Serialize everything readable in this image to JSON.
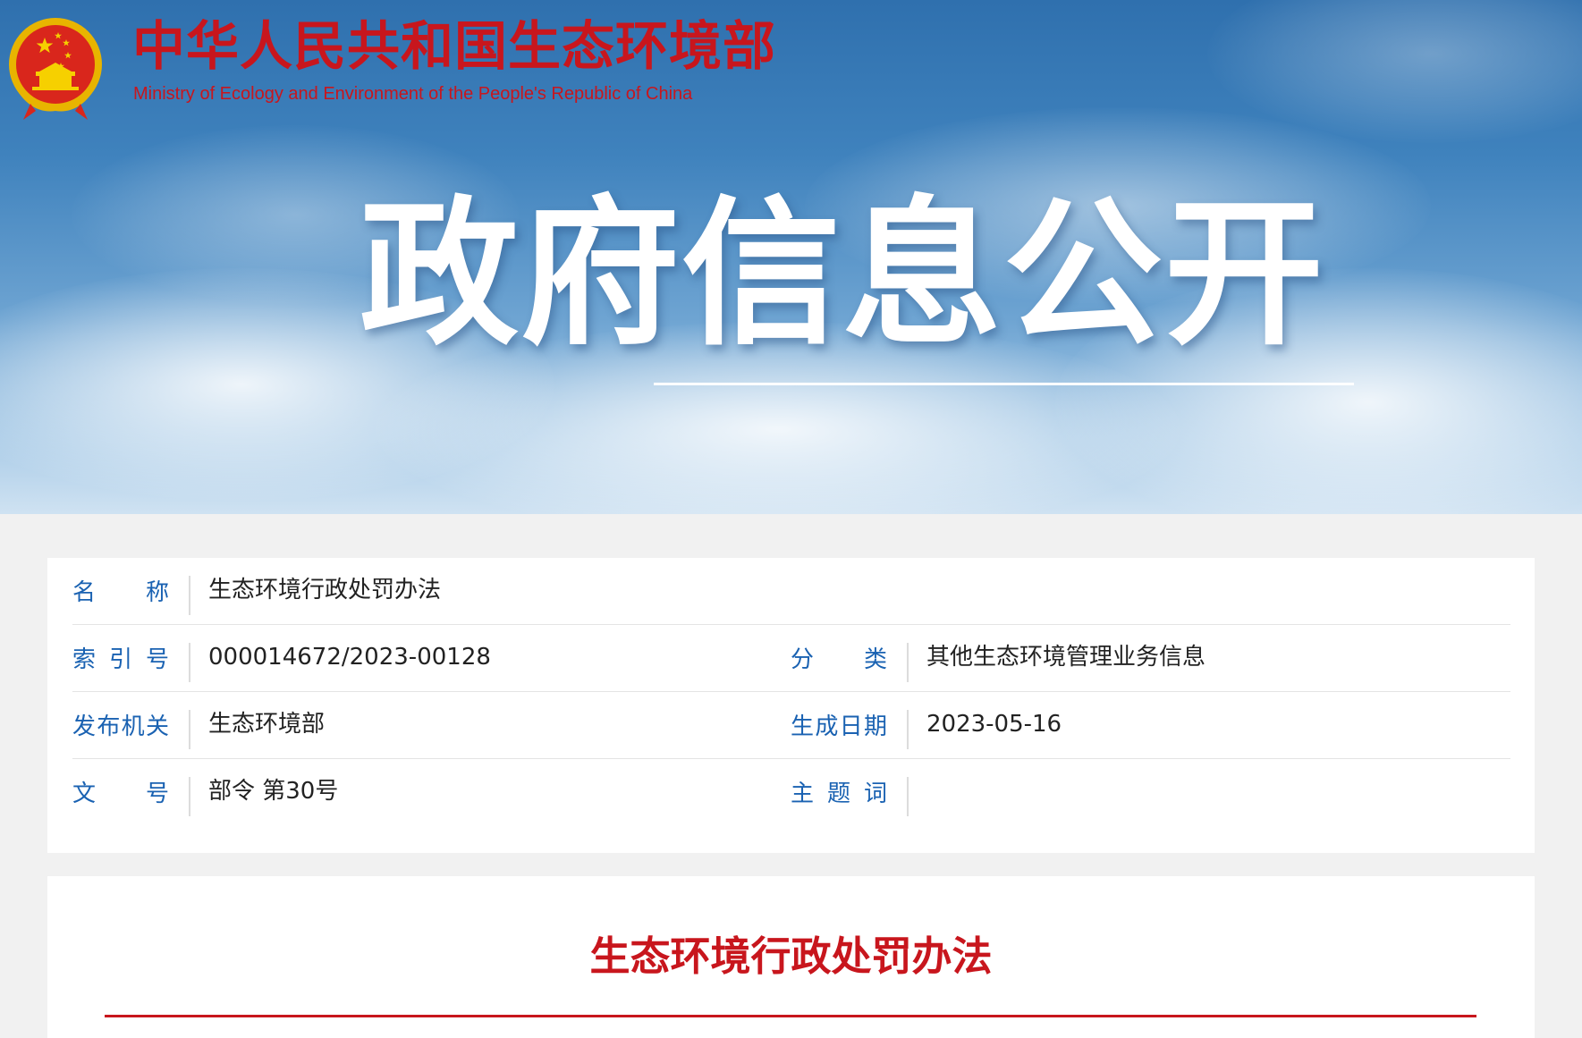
{
  "header": {
    "ministry_name_cn": "中华人民共和国生态环境部",
    "ministry_name_en": "Ministry of Ecology and Environment of the People's Republic of China",
    "emblem_icon": "national-emblem-icon",
    "banner_title": "政府信息公开"
  },
  "info": {
    "name_label": "名称",
    "name_value": "生态环境行政处罚办法",
    "index_label": "索引号",
    "index_value": "000014672/2023-00128",
    "category_label": "分类",
    "category_value": "其他生态环境管理业务信息",
    "publisher_label": "发布机关",
    "publisher_value": "生态环境部",
    "date_label": "生成日期",
    "date_value": "2023-05-16",
    "doc_no_label": "文号",
    "doc_no_value": "部令 第30号",
    "keywords_label": "主题词",
    "keywords_value": ""
  },
  "article": {
    "title": "生态环境行政处罚办法"
  },
  "colors": {
    "brand_red": "#c8161d",
    "label_blue": "#1a62b2",
    "banner_blue": "#3f82bd"
  }
}
